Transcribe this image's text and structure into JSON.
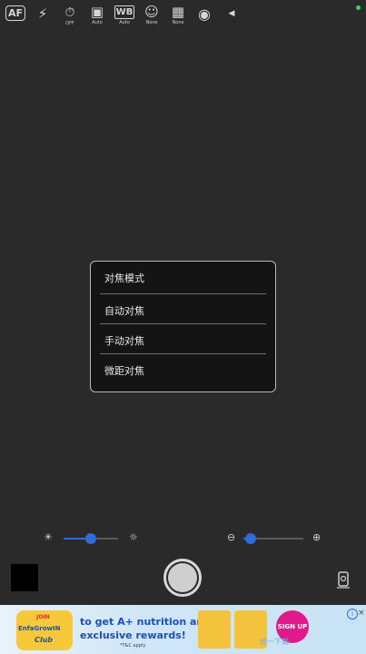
{
  "toolbar": {
    "items": [
      {
        "icon": "af-icon",
        "text": "AF",
        "sub": ""
      },
      {
        "icon": "flash-icon",
        "text": "⚡",
        "sub": ""
      },
      {
        "icon": "timer-off-icon",
        "text": "⏱",
        "sub": "OFF"
      },
      {
        "icon": "image-auto-icon",
        "text": "▣",
        "sub": "Auto"
      },
      {
        "icon": "white-balance-icon",
        "text": "WB",
        "sub": "Auto"
      },
      {
        "icon": "face-detect-icon",
        "text": "☺",
        "sub": "None"
      },
      {
        "icon": "grid-icon",
        "text": "▦",
        "sub": "None"
      },
      {
        "icon": "capture-settings-icon",
        "text": "◉",
        "sub": ""
      },
      {
        "icon": "chevron-left-icon",
        "text": "◀",
        "sub": ""
      }
    ],
    "status_color": "#37d26b"
  },
  "focus_menu": {
    "title": "对焦模式",
    "options": [
      "自动对焦",
      "手动对焦",
      "微距对焦"
    ]
  },
  "controls": {
    "exposure": {
      "left_icon": "brightness-low-icon",
      "right_icon": "brightness-high-icon",
      "value": 0.5
    },
    "zoom": {
      "left_icon": "zoom-out-icon",
      "right_icon": "zoom-in-icon",
      "value": 0.12
    }
  },
  "bottom": {
    "shutter": "shutter-button",
    "switch_camera": "switch-camera-icon"
  },
  "ad": {
    "brand_top": "JOIN",
    "brand_name": "EnfaGrowIN",
    "brand_sub": "Club",
    "line1": "to get A+ nutrition and",
    "line2": "exclusive rewards!",
    "tc": "*T&C apply",
    "cta": "SIGN UP",
    "info": "i",
    "close": "×",
    "watermark": "统一下载"
  }
}
